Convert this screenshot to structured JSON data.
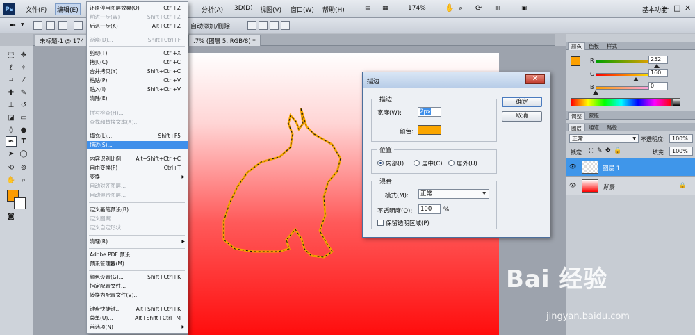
{
  "app": {
    "logo": "Ps",
    "zoom": "174%",
    "workspace": "基本功能"
  },
  "menubar": {
    "items": [
      "文件(F)",
      "编辑(E)",
      "分析(A)",
      "3D(D)",
      "视图(V)",
      "窗口(W)",
      "帮助(H)"
    ],
    "win_buttons": [
      "—",
      "□",
      "✕"
    ]
  },
  "options": {
    "auto_add_delete": "自动添加/删除"
  },
  "tabs": {
    "doc1": "未标题-1 @ 174",
    "doc2": ".7% (图层 5, RGB/8) *"
  },
  "edit_menu": {
    "items": [
      {
        "label": "还原停用图层效果(O)",
        "shortcut": "Ctrl+Z"
      },
      {
        "label": "前进一步(W)",
        "shortcut": "Shift+Ctrl+Z",
        "disabled": true
      },
      {
        "label": "后退一步(K)",
        "shortcut": "Alt+Ctrl+Z"
      },
      {
        "label": "渐隐(D)...",
        "shortcut": "Shift+Ctrl+F",
        "disabled": true
      },
      {
        "label": "剪切(T)",
        "shortcut": "Ctrl+X"
      },
      {
        "label": "拷贝(C)",
        "shortcut": "Ctrl+C"
      },
      {
        "label": "合并拷贝(Y)",
        "shortcut": "Shift+Ctrl+C"
      },
      {
        "label": "粘贴(P)",
        "shortcut": "Ctrl+V"
      },
      {
        "label": "贴入(I)",
        "shortcut": "Shift+Ctrl+V"
      },
      {
        "label": "清除(E)",
        "shortcut": ""
      },
      {
        "label": "拼写检查(H)...",
        "shortcut": "",
        "disabled": true
      },
      {
        "label": "查找和替换文本(X)...",
        "shortcut": "",
        "disabled": true
      },
      {
        "label": "填充(L)...",
        "shortcut": "Shift+F5"
      },
      {
        "label": "描边(S)...",
        "shortcut": "",
        "highlight": true
      },
      {
        "label": "内容识别比例",
        "shortcut": "Alt+Shift+Ctrl+C"
      },
      {
        "label": "自由变换(F)",
        "shortcut": "Ctrl+T"
      },
      {
        "label": "变换",
        "shortcut": "",
        "submenu": true
      },
      {
        "label": "自动对齐图层...",
        "shortcut": "",
        "disabled": true
      },
      {
        "label": "自动混合图层...",
        "shortcut": "",
        "disabled": true
      },
      {
        "label": "定义画笔预设(B)...",
        "shortcut": ""
      },
      {
        "label": "定义图案...",
        "shortcut": "",
        "disabled": true
      },
      {
        "label": "定义自定形状...",
        "shortcut": "",
        "disabled": true
      },
      {
        "label": "清理(R)",
        "shortcut": "",
        "submenu": true
      },
      {
        "label": "Adobe PDF 预设...",
        "shortcut": ""
      },
      {
        "label": "预设管理器(M)...",
        "shortcut": ""
      },
      {
        "label": "颜色设置(G)...",
        "shortcut": "Shift+Ctrl+K"
      },
      {
        "label": "指定配置文件...",
        "shortcut": ""
      },
      {
        "label": "转换为配置文件(V)...",
        "shortcut": ""
      },
      {
        "label": "键盘快捷键...",
        "shortcut": "Alt+Shift+Ctrl+K"
      },
      {
        "label": "菜单(U)...",
        "shortcut": "Alt+Shift+Ctrl+M"
      },
      {
        "label": "首选项(N)",
        "shortcut": "",
        "submenu": true
      }
    ]
  },
  "stroke_dialog": {
    "title": "描边",
    "close": "✕",
    "stroke_group": "描边",
    "width_label": "宽度(W):",
    "width_value": "2px",
    "color_label": "颜色:",
    "stroke_color": "#fba600",
    "position_group": "位置",
    "position_options": [
      "内部(I)",
      "居中(C)",
      "居外(U)"
    ],
    "blend_group": "混合",
    "mode_label": "模式(M):",
    "mode_value": "正常",
    "opacity_label": "不透明度(O):",
    "opacity_value": "100",
    "opacity_unit": "%",
    "preserve_label": "保留透明区域(P)",
    "ok": "确定",
    "cancel": "取消"
  },
  "color_panel": {
    "tabs": [
      "颜色",
      "色板",
      "样式"
    ],
    "channels": [
      {
        "name": "R",
        "value": "252"
      },
      {
        "name": "G",
        "value": "160"
      },
      {
        "name": "B",
        "value": "0"
      }
    ],
    "foreground": "#fca000"
  },
  "adjust_panel": {
    "tabs": [
      "调整",
      "蒙版"
    ]
  },
  "layers_panel": {
    "tabs": [
      "图层",
      "通道",
      "路径"
    ],
    "blend_mode": "正常",
    "opacity_label": "不透明度:",
    "opacity_value": "100%",
    "lock_label": "锁定:",
    "fill_label": "填充:",
    "fill_value": "100%",
    "layers": [
      {
        "name": "图层 1",
        "selected": true
      },
      {
        "name": "背景",
        "selected": false
      }
    ]
  },
  "watermark": {
    "logo": "Bai 经验",
    "url": "jingyan.baidu.com"
  }
}
